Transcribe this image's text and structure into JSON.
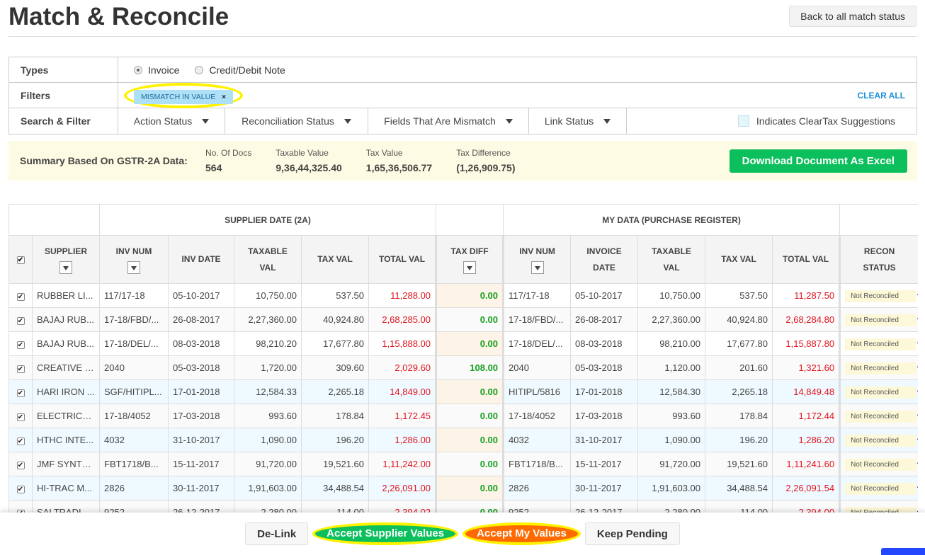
{
  "page_title": "Match & Reconcile",
  "back_button": "Back to all match status",
  "types": {
    "label": "Types",
    "options": [
      {
        "label": "Invoice",
        "selected": true
      },
      {
        "label": "Credit/Debit Note",
        "selected": false
      }
    ]
  },
  "filters": {
    "label": "Filters",
    "chip": "MISMATCH IN VALUE",
    "chip_close": "×",
    "clear_all": "CLEAR ALL"
  },
  "search_filter": {
    "label": "Search & Filter",
    "dropdowns": [
      "Action Status",
      "Reconciliation Status",
      "Fields That Are Mismatch",
      "Link Status"
    ],
    "suggestion_legend": "Indicates ClearTax Suggestions"
  },
  "summary": {
    "label": "Summary Based On GSTR-2A Data:",
    "stats": [
      {
        "k": "No. Of Docs",
        "v": "564"
      },
      {
        "k": "Taxable Value",
        "v": "9,36,44,325.40"
      },
      {
        "k": "Tax Value",
        "v": "1,65,36,506.77"
      },
      {
        "k": "Tax Difference",
        "v": "(1,26,909.75)"
      }
    ],
    "download": "Download Document As Excel"
  },
  "table": {
    "group_supplier": "SUPPLIER DATE (2A)",
    "group_mine": "MY DATA (PURCHASE REGISTER)",
    "headers": [
      "SUPPLIER",
      "INV NUM",
      "INV DATE",
      "TAXABLE VAL",
      "TAX VAL",
      "TOTAL VAL",
      "TAX DIFF",
      "INV NUM",
      "INVOICE DATE",
      "TAXABLE VAL",
      "TAX VAL",
      "TOTAL VAL",
      "RECON STATUS"
    ],
    "rows": [
      [
        "RUBBER LI...",
        "117/17-18",
        "05-10-2017",
        "10,750.00",
        "537.50",
        "11,288.00",
        "0.00",
        "117/17-18",
        "05-10-2017",
        "10,750.00",
        "537.50",
        "11,287.50",
        "Not Reconciled"
      ],
      [
        "BAJAJ RUB...",
        "17-18/FBD/...",
        "26-08-2017",
        "2,27,360.00",
        "40,924.80",
        "2,68,285.00",
        "0.00",
        "17-18/FBD/...",
        "26-08-2017",
        "2,27,360.00",
        "40,924.80",
        "2,68,284.80",
        "Not Reconciled"
      ],
      [
        "BAJAJ RUB...",
        "17-18/DEL/...",
        "08-03-2018",
        "98,210.20",
        "17,677.80",
        "1,15,888.00",
        "0.00",
        "17-18/DEL/...",
        "08-03-2018",
        "98,210.00",
        "17,677.80",
        "1,15,887.80",
        "Not Reconciled"
      ],
      [
        "CREATIVE C...",
        "2040",
        "05-03-2018",
        "1,720.00",
        "309.60",
        "2,029.60",
        "108.00",
        "2040",
        "05-03-2018",
        "1,120.00",
        "201.60",
        "1,321.60",
        "Not Reconciled"
      ],
      [
        "HARI IRON ...",
        "SGF/HITIPL...",
        "17-01-2018",
        "12,584.33",
        "2,265.18",
        "14,849.00",
        "0.00",
        "HITIPL/5816",
        "17-01-2018",
        "12,584.30",
        "2,265.18",
        "14,849.48",
        "Not Reconciled"
      ],
      [
        "ELECTRICA...",
        "17-18/4052",
        "17-03-2018",
        "993.60",
        "178.84",
        "1,172.45",
        "0.00",
        "17-18/4052",
        "17-03-2018",
        "993.60",
        "178.84",
        "1,172.44",
        "Not Reconciled"
      ],
      [
        "HTHC INTE...",
        "4032",
        "31-10-2017",
        "1,090.00",
        "196.20",
        "1,286.00",
        "0.00",
        "4032",
        "31-10-2017",
        "1,090.00",
        "196.20",
        "1,286.20",
        "Not Reconciled"
      ],
      [
        "JMF SYNTH...",
        "FBT1718/B...",
        "15-11-2017",
        "91,720.00",
        "19,521.60",
        "1,11,242.00",
        "0.00",
        "FBT1718/B...",
        "15-11-2017",
        "91,720.00",
        "19,521.60",
        "1,11,241.60",
        "Not Reconciled"
      ],
      [
        "HI-TRAC M...",
        "2826",
        "30-11-2017",
        "1,91,603.00",
        "34,488.54",
        "2,26,091.00",
        "0.00",
        "2826",
        "30-11-2017",
        "1,91,603.00",
        "34,488.54",
        "2,26,091.54",
        "Not Reconciled"
      ],
      [
        "SALTRADIN...",
        "9252",
        "26-12-2017",
        "2,280.00",
        "114.00",
        "2,394.02",
        "0.00",
        "9252",
        "26-12-2017",
        "2,280.00",
        "114.00",
        "2,394.00",
        "Not Reconciled"
      ]
    ],
    "suggested_rows": [
      4,
      6,
      8
    ]
  },
  "actions": {
    "delink": "De-Link",
    "accept_supplier": "Accept Supplier Values",
    "accept_mine": "Accept My Values",
    "keep_pending": "Keep Pending"
  },
  "colors": {
    "accent_green": "#0bbf5c",
    "accent_orange": "#ff6a00",
    "link_blue": "#1a8fd8",
    "value_red": "#e0141e",
    "diff_green": "#14a01e"
  }
}
